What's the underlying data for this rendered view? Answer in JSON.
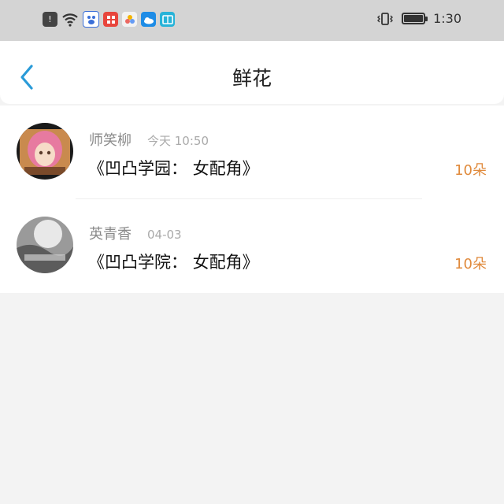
{
  "status_bar": {
    "time": "1:30",
    "left_icons": [
      "alert-icon",
      "wifi-icon",
      "baidu-app-icon",
      "app-red-icon",
      "app-colorful-icon",
      "weather-app-icon",
      "reader-app-icon"
    ],
    "right_icons": [
      "vibrate-icon",
      "battery-icon"
    ]
  },
  "header": {
    "title": "鲜花",
    "back_icon": "chevron-left-icon",
    "accent_color": "#2a9bd8"
  },
  "gifts": [
    {
      "sender": "师笑柳",
      "date": "今天 10:50",
      "book": "《凹凸学园： 女配角》",
      "count": "10朵"
    },
    {
      "sender": "英青香",
      "date": "04-03",
      "book": "《凹凸学院： 女配角》",
      "count": "10朵"
    }
  ],
  "colors": {
    "count": "#e08a3c",
    "status_bar": "#d4d4d4"
  }
}
